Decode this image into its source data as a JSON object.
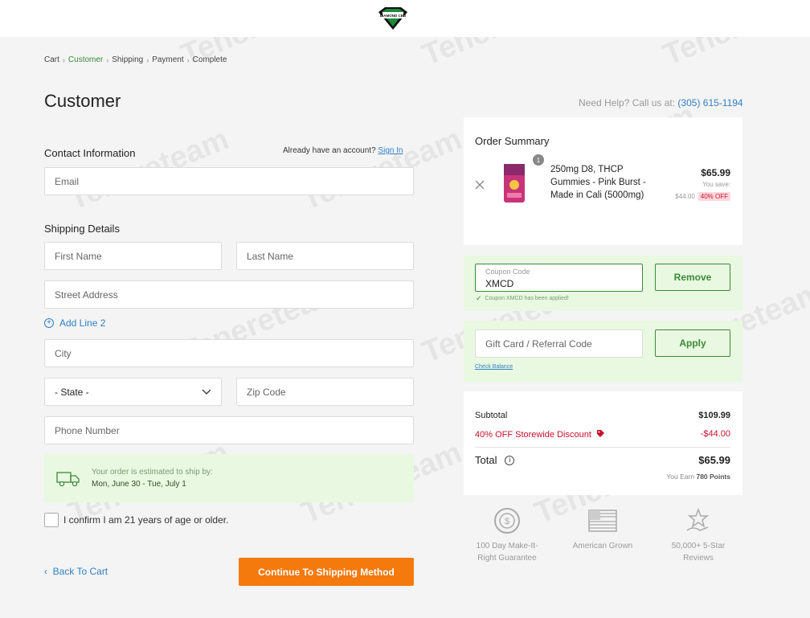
{
  "brand": {
    "logo_text": "DIAMOND CBD"
  },
  "breadcrumb": [
    {
      "label": "Cart"
    },
    {
      "label": "Customer"
    },
    {
      "label": "Shipping"
    },
    {
      "label": "Payment"
    },
    {
      "label": "Complete"
    }
  ],
  "page": {
    "title": "Customer"
  },
  "help": {
    "prefix": "Need Help? Call us at:",
    "phone": "(305) 615-1194"
  },
  "contact": {
    "heading": "Contact Information",
    "account_prompt": "Already have an account?",
    "signin_label": "Sign In",
    "email_placeholder": "Email"
  },
  "shipping": {
    "heading": "Shipping Details",
    "first_name": "First Name",
    "last_name": "Last Name",
    "street": "Street Address",
    "add_line2": "Add Line 2",
    "city": "City",
    "state": "- State -",
    "zip": "Zip Code",
    "phone": "Phone Number",
    "estimate_line1": "Your order is estimated to ship by:",
    "estimate_line2": "Mon, June 30 - Tue, July 1"
  },
  "age": {
    "label": "I confirm I am 21 years of age or older."
  },
  "actions": {
    "back": "Back To Cart",
    "continue": "Continue To Shipping Method"
  },
  "summary": {
    "heading": "Order Summary",
    "item": {
      "qty": "1",
      "name": "250mg D8, THCP Gummies - Pink Burst - Made in Cali (5000mg)",
      "price": "$65.99",
      "you_save": "You save:",
      "orig_price": "$44.00",
      "discount_badge": "40% OFF"
    }
  },
  "coupon": {
    "label": "Coupon Code",
    "value": "XMCD",
    "button": "Remove",
    "applied_note": "Coupon XMCD has been applied!"
  },
  "giftcard": {
    "placeholder": "Gift Card / Referral Code",
    "button": "Apply",
    "check_balance": "Check Balance"
  },
  "totals": {
    "subtotal_label": "Subtotal",
    "subtotal_value": "$109.99",
    "discount_label": "40% OFF Storewide Discount",
    "discount_value": "-$44.00",
    "total_label": "Total",
    "total_value": "$65.99",
    "earn_prefix": "You Earn",
    "earn_points": "780 Points"
  },
  "features": [
    {
      "line1": "100 Day Make-It-",
      "line2": "Right Guarantee"
    },
    {
      "line1": "American Grown",
      "line2": ""
    },
    {
      "line1": "50,000+ 5-Star",
      "line2": "Reviews"
    }
  ],
  "colors": {
    "accent_green": "#3a8a3a",
    "cta_orange": "#f57a0e",
    "link_blue": "#2f7fc5",
    "discount_red": "#c8102e",
    "light_green": "#e9f8e0"
  }
}
